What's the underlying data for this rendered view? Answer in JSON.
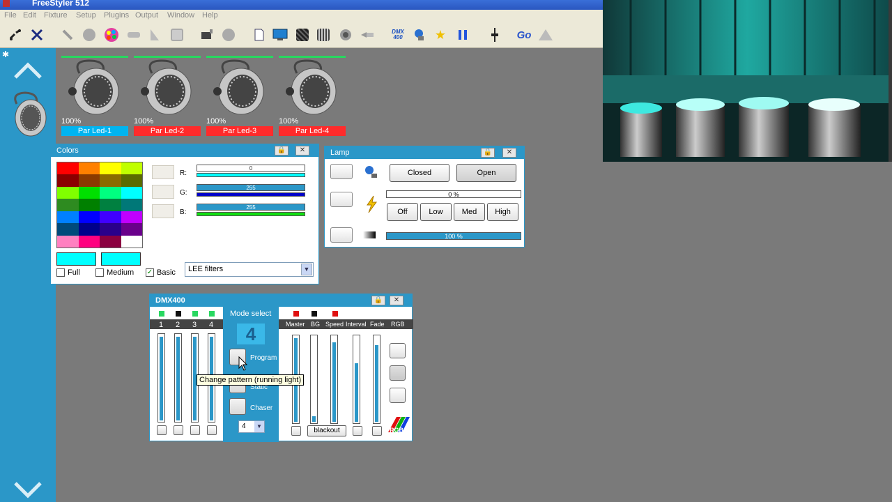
{
  "app": {
    "title": "FreeStyler 512"
  },
  "menu": [
    "File",
    "Edit",
    "Fixture",
    "Setup",
    "Plugins",
    "Output",
    "Window",
    "Help"
  ],
  "toolbar": {
    "dmx_label": "DMX\n400",
    "go_label": "Go"
  },
  "fixtures": [
    {
      "name": "Par Led-1",
      "percent": "100%",
      "color": "#00b4f0"
    },
    {
      "name": "Par Led-2",
      "percent": "100%",
      "color": "#ff2b2b"
    },
    {
      "name": "Par Led-3",
      "percent": "100%",
      "color": "#ff2b2b"
    },
    {
      "name": "Par Led-4",
      "percent": "100%",
      "color": "#ff2b2b"
    }
  ],
  "colors_window": {
    "title": "Colors",
    "r_label": "R:",
    "g_label": "G:",
    "b_label": "B:",
    "r_value": "0",
    "g_value": "255",
    "b_value": "255",
    "full_label": "Full",
    "medium_label": "Medium",
    "basic_label": "Basic",
    "basic_checked": true,
    "filter_select": "LEE filters",
    "palette": [
      "#ff0000",
      "#ff8000",
      "#ffff00",
      "#c0ff00",
      "#8b0000",
      "#8b3a00",
      "#8b6b00",
      "#5a6b00",
      "#80ff00",
      "#00e000",
      "#00ff80",
      "#00ffff",
      "#2e8b20",
      "#008000",
      "#008040",
      "#007878",
      "#0080ff",
      "#0000ff",
      "#4000ff",
      "#c000ff",
      "#004a7a",
      "#00008b",
      "#2a008b",
      "#6a008b",
      "#ff80c0",
      "#ff0080",
      "#8b0040",
      "#ffffff"
    ]
  },
  "lamp_window": {
    "title": "Lamp",
    "closed_label": "Closed",
    "open_label": "Open",
    "dimmer_value": "0 %",
    "off_label": "Off",
    "low_label": "Low",
    "med_label": "Med",
    "high_label": "High",
    "shutter_value": "100 %"
  },
  "dmx_window": {
    "title": "DMX400",
    "channels": [
      "1",
      "2",
      "3",
      "4"
    ],
    "mode_select_label": "Mode select",
    "mode_value": "4",
    "program_label": "Program",
    "static_label": "Static",
    "chaser_label": "Chaser",
    "chaser_select": "4",
    "master_label": "Master",
    "bg_label": "BG",
    "speed_label": "Speed",
    "interval_label": "Interval",
    "fade_label": "Fade",
    "rgb_label": "RGB",
    "blackout_label": "blackout",
    "tooltip": "Change pattern (running light)",
    "rgb_logo_text": "RGB"
  }
}
